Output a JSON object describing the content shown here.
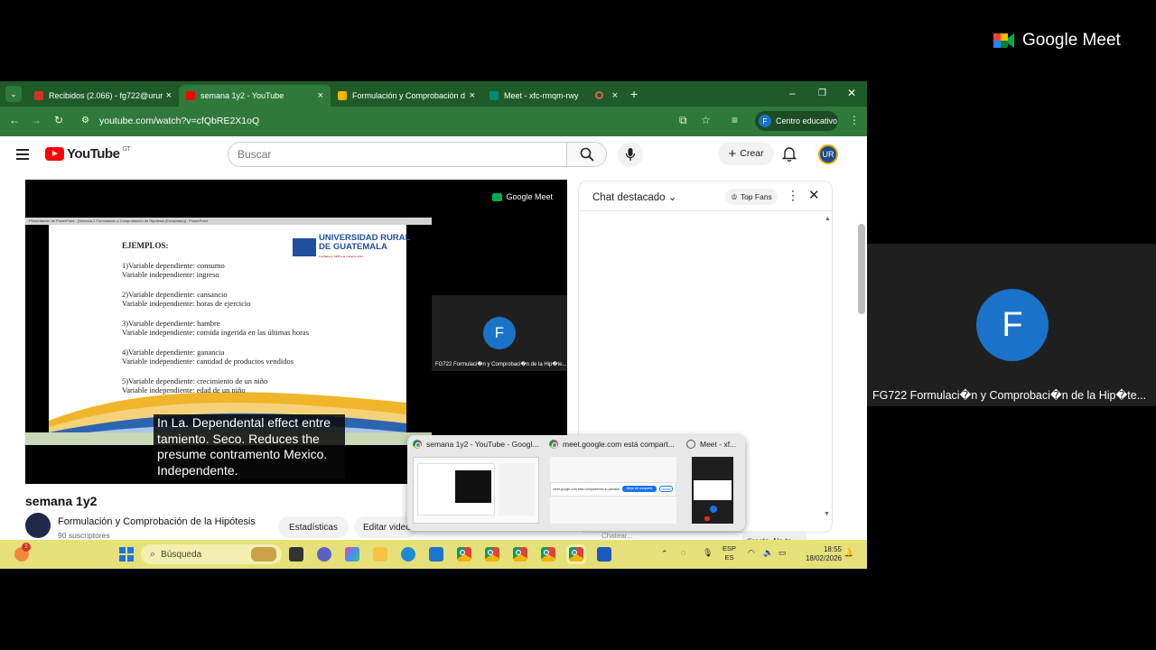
{
  "meet": {
    "brand": "Google Meet",
    "participant_initial": "F",
    "participant_name": "FG722 Formulaci�n y Comprobaci�n de la Hip�te..."
  },
  "browser": {
    "tabs": [
      {
        "label": "Recibidos (2.066) - fg722@urur",
        "color": "#d93025"
      },
      {
        "label": "semana 1y2 - YouTube",
        "color": "#ff0000"
      },
      {
        "label": "Formulación y Comprobación d",
        "color": "#f4b400"
      },
      {
        "label": "Meet - xfc-rmqm-rwy",
        "color": "#00897b"
      }
    ],
    "url": "youtube.com/watch?v=cfQbRE2X1oQ",
    "profile_label": "Centro educativo",
    "profile_initial": "F"
  },
  "youtube": {
    "logo_text": "YouTube",
    "country": "GT",
    "search_placeholder": "Buscar",
    "create_label": "Crear",
    "video_title": "semana 1y2",
    "channel_name": "Formulación y Comprobación de la Hipótesis",
    "subscribers": "90 suscriptores",
    "stats_button": "Estadísticas",
    "edit_button": "Editar video"
  },
  "video": {
    "meet_watermark": "Google Meet",
    "slide_window_title": "Presentación de PowerPoint - [Semana 2 Formulación y Comprobación de Hipótesis (Encriptado)] - PowerPoint",
    "slide_heading": "EJEMPLOS:",
    "slide_items": [
      [
        "1)Variable dependiente: consumo",
        "Variable independiente: ingreso"
      ],
      [
        "2)Variable dependiente: cansancio",
        "Variable independiente:  horas de ejercicio"
      ],
      [
        "3)Variable dependiente: hambre",
        "Variable independiente: comida ingerida en las últimas horas"
      ],
      [
        "4)Variable dependiente: ganancia",
        "Variable independiente: cantidad de productos vendidos"
      ],
      [
        "5)Variable dependiente: crecimiento de un niño",
        "Variable independiente: edad de un niño"
      ]
    ],
    "university_line1": "UNIVERSIDAD RURAL",
    "university_line2": "DE GUATEMALA",
    "university_sub": "Fundada en 1995 a la presente 2011",
    "participant_initial": "F",
    "participant_name": "FG722 Formulaci�n y Comprobaci�n de la Hip�te...",
    "caption": "In La. Dependental effect entre tamiento. Seco. Reduces the presume contramento Mexico. Independente."
  },
  "chat": {
    "title": "Chat destacado",
    "top_fans": "Top Fans",
    "message": "directo. No te cumplir las",
    "input_hint": "Chatear..."
  },
  "switcher": {
    "items": [
      "semana 1y2 - YouTube - Googl...",
      "meet.google.com está compart...",
      "Meet - xf..."
    ],
    "share_notice": "meet.google.com está compartiendo tu pantalla",
    "share_stop": "Dejar de compartir",
    "share_hide": "Ocultar"
  },
  "taskbar": {
    "search_label": "Búsqueda",
    "lang_top": "ESP",
    "lang_bottom": "ES",
    "time": "18:55",
    "date": "18/02/2026",
    "badge_count": "2"
  }
}
